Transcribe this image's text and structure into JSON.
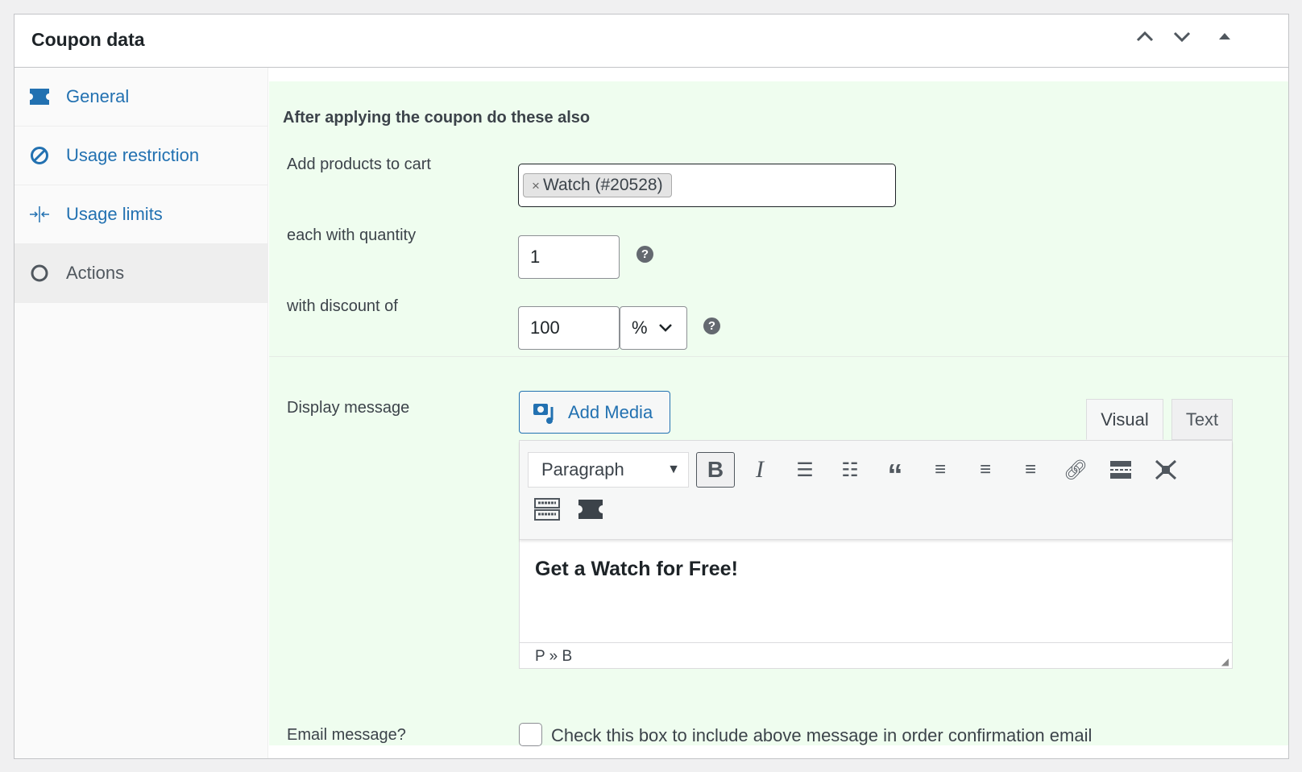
{
  "panel": {
    "title": "Coupon data",
    "controls": [
      "chevron-up-icon",
      "chevron-down-icon",
      "triangle-up-icon"
    ]
  },
  "sidebar": {
    "items": [
      {
        "label": "General",
        "icon": "ticket-icon",
        "active": false
      },
      {
        "label": "Usage restriction",
        "icon": "no-entry-icon",
        "active": false
      },
      {
        "label": "Usage limits",
        "icon": "compress-icon",
        "active": false
      },
      {
        "label": "Actions",
        "icon": "gear-icon",
        "active": true
      }
    ]
  },
  "actions": {
    "heading": "After applying the coupon do these also",
    "add_products_label": "Add products to cart",
    "product_chip": "Watch (#20528)",
    "chip_remove": "×",
    "quantity_label": "each with quantity",
    "quantity_value": "1",
    "discount_label": "with discount of",
    "discount_value": "100",
    "discount_type": "%",
    "help": "?",
    "display_message_label": "Display message",
    "add_media": "Add Media",
    "tab_visual": "Visual",
    "tab_text": "Text",
    "format_select": "Paragraph",
    "message": "Get a Watch for Free!",
    "path": "P » B",
    "email_label": "Email message?",
    "email_checkbox_label": "Check this box to include above message in order confirmation email",
    "email_checked": false
  },
  "colors": {
    "accent": "#2271b1",
    "section_bg": "#effdef"
  }
}
